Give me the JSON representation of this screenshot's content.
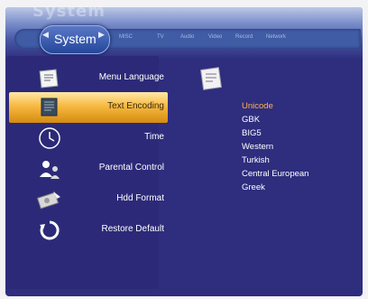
{
  "header": {
    "title": "System",
    "tabs": [
      "MISC",
      "TV",
      "Audio",
      "Video",
      "Record",
      "Network"
    ]
  },
  "menu": {
    "items": [
      {
        "label": "Menu Language",
        "icon": "flag-doc-icon",
        "selected": false
      },
      {
        "label": "Text Encoding",
        "icon": "flag-doc-icon",
        "selected": true
      },
      {
        "label": "Time",
        "icon": "clock-icon",
        "selected": false
      },
      {
        "label": "Parental Control",
        "icon": "family-icon",
        "selected": false
      },
      {
        "label": "Hdd Format",
        "icon": "hdd-icon",
        "selected": false
      },
      {
        "label": "Restore Default",
        "icon": "restore-icon",
        "selected": false
      }
    ]
  },
  "encoding": {
    "options": [
      "Unicode",
      "GBK",
      "BIG5",
      "Western",
      "Turkish",
      "Central European",
      "Greek"
    ],
    "selected": "Unicode"
  },
  "colors": {
    "background": "#2e2d7e",
    "highlight": "#f7b941",
    "selected_text": "#ffb54a"
  }
}
